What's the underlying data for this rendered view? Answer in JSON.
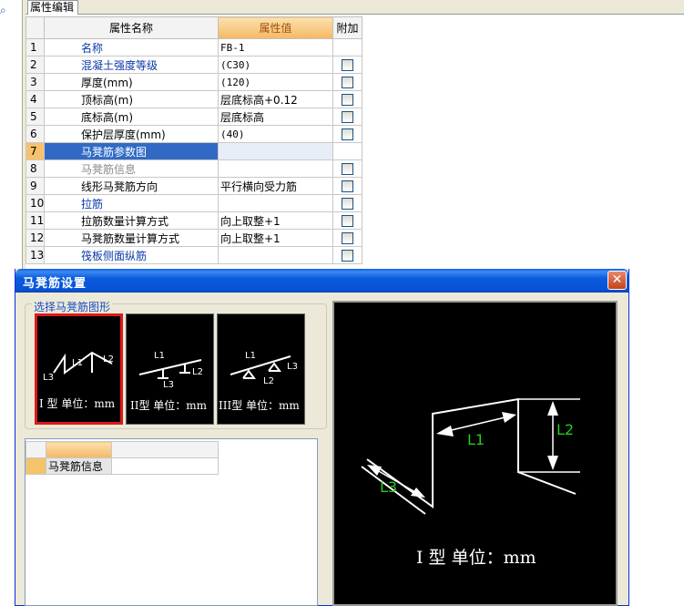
{
  "left": {
    "search_icon": "search-icon"
  },
  "tab": {
    "label": "属性编辑"
  },
  "property_grid": {
    "headers": {
      "name": "属性名称",
      "value": "属性值",
      "extra": "附加"
    },
    "rows": [
      {
        "num": "1",
        "name": "名称",
        "value": "FB-1",
        "style": "blue",
        "checkbox": false
      },
      {
        "num": "2",
        "name": "混凝土强度等级",
        "value": "(C30)",
        "style": "blue",
        "checkbox": true
      },
      {
        "num": "3",
        "name": "厚度(mm)",
        "value": "(120)",
        "style": "",
        "checkbox": true
      },
      {
        "num": "4",
        "name": "顶标高(m)",
        "value": "层底标高+0.12",
        "style": "",
        "checkbox": true
      },
      {
        "num": "5",
        "name": "底标高(m)",
        "value": "层底标高",
        "style": "",
        "checkbox": true
      },
      {
        "num": "6",
        "name": "保护层厚度(mm)",
        "value": "(40)",
        "style": "",
        "checkbox": true
      },
      {
        "num": "7",
        "name": "马凳筋参数图",
        "value": "",
        "style": "selected",
        "checkbox": false
      },
      {
        "num": "8",
        "name": "马凳筋信息",
        "value": "",
        "style": "gray",
        "checkbox": true
      },
      {
        "num": "9",
        "name": "线形马凳筋方向",
        "value": "平行横向受力筋",
        "style": "",
        "checkbox": true
      },
      {
        "num": "10",
        "name": "拉筋",
        "value": "",
        "style": "blue",
        "checkbox": true
      },
      {
        "num": "11",
        "name": "拉筋数量计算方式",
        "value": "向上取整+1",
        "style": "",
        "checkbox": true
      },
      {
        "num": "12",
        "name": "马凳筋数量计算方式",
        "value": "向上取整+1",
        "style": "",
        "checkbox": true
      },
      {
        "num": "13",
        "name": "筏板侧面纵筋",
        "value": "",
        "style": "blue",
        "checkbox": true
      }
    ]
  },
  "dialog": {
    "title": "马凳筋设置",
    "close_label": "✕",
    "shape_group_label": "选择马凳筋图形",
    "thumbnails": [
      {
        "caption": "I 型  单位：mm",
        "labels": [
          "L1",
          "L2",
          "L3"
        ],
        "selected": true
      },
      {
        "caption": "II型  单位：mm",
        "labels": [
          "L1",
          "L2",
          "L3"
        ],
        "selected": false
      },
      {
        "caption": "III型  单位：mm",
        "labels": [
          "L1",
          "L3",
          "L2"
        ],
        "selected": false
      }
    ],
    "info_grid": {
      "row_label": "马凳筋信息",
      "row_value": ""
    },
    "preview": {
      "labels": {
        "l1": "L1",
        "l2": "L2",
        "l3": "L3"
      },
      "caption": "I 型  单位：mm",
      "line_color": "#ffffff",
      "label_color": "#22cc22"
    }
  }
}
